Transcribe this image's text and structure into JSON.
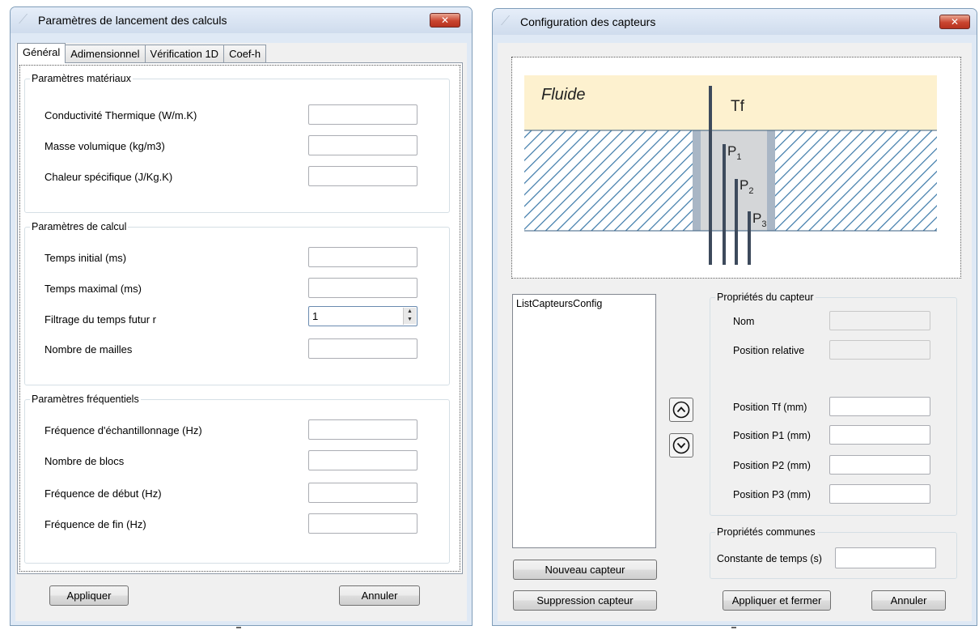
{
  "left_window": {
    "title": "Paramètres de lancement des calculs",
    "close_label": "✕",
    "tabs": [
      "Général",
      "Adimensionnel",
      "Vérification 1D",
      "Coef-h"
    ],
    "groups": {
      "materiaux": {
        "legend": "Paramètres matériaux",
        "fields": [
          "Conductivité Thermique (W/m.K)",
          "Masse volumique (kg/m3)",
          "Chaleur spécifique (J/Kg.K)"
        ]
      },
      "calcul": {
        "legend": "Paramètres de calcul",
        "fields": [
          "Temps initial (ms)",
          "Temps maximal (ms)",
          "Filtrage du temps futur r",
          "Nombre de mailles"
        ],
        "filtrage_value": "1"
      },
      "frequentiels": {
        "legend": "Paramètres fréquentiels",
        "fields": [
          "Fréquence d'échantillonnage (Hz)",
          "Nombre de blocs",
          "Fréquence de début (Hz)",
          "Fréquence de fin (Hz)"
        ]
      }
    },
    "buttons": {
      "apply": "Appliquer",
      "cancel": "Annuler"
    }
  },
  "right_window": {
    "title": "Configuration des capteurs",
    "close_label": "✕",
    "diagram": {
      "fluid_label": "Fluide",
      "tf_label": "Tf",
      "p_labels": [
        {
          "main": "P",
          "sub": "1"
        },
        {
          "main": "P",
          "sub": "2"
        },
        {
          "main": "P",
          "sub": "3"
        }
      ],
      "colors": {
        "fluid": "#fdf1cf",
        "hatch": "#3a78a8",
        "cavity": "#d4d6d8",
        "cavity_edge": "#a9b6c5",
        "probe": "#3d4a5c"
      }
    },
    "listbox_header": "ListCapteursConfig",
    "sensor_props": {
      "legend": "Propriétés du capteur",
      "name_label": "Nom",
      "position_label": "Position relative",
      "fields": [
        "Position Tf (mm)",
        "Position P1 (mm)",
        "Position P2 (mm)",
        "Position P3 (mm)"
      ]
    },
    "common_props": {
      "legend": "Propriétés communes",
      "time_constant_label": "Constante de temps (s)"
    },
    "buttons": {
      "new_sensor": "Nouveau capteur",
      "delete_sensor": "Suppression capteur",
      "apply_close": "Appliquer et fermer",
      "cancel": "Annuler"
    }
  }
}
